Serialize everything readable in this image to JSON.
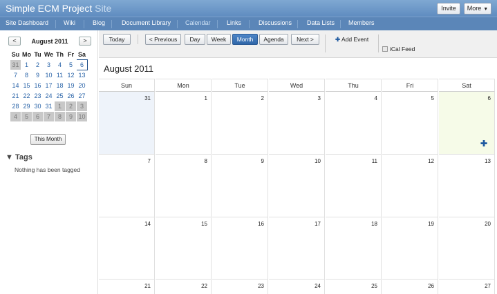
{
  "header": {
    "site_name": "Simple ECM Project",
    "site_suffix": "Site",
    "invite_label": "Invite",
    "more_label": "More"
  },
  "nav": {
    "items": [
      {
        "label": "Site Dashboard"
      },
      {
        "label": "Wiki"
      },
      {
        "label": "Blog"
      },
      {
        "label": "Document Library"
      },
      {
        "label": "Calendar"
      },
      {
        "label": "Links"
      },
      {
        "label": "Discussions"
      },
      {
        "label": "Data Lists"
      },
      {
        "label": "Members"
      }
    ],
    "active": "Calendar"
  },
  "mini_calendar": {
    "prev_label": "<",
    "next_label": ">",
    "month_label": "August 2011",
    "weekdays": [
      "Su",
      "Mo",
      "Tu",
      "We",
      "Th",
      "Fr",
      "Sa"
    ],
    "weeks": [
      [
        "31",
        "1",
        "2",
        "3",
        "4",
        "5",
        "6"
      ],
      [
        "7",
        "8",
        "9",
        "10",
        "11",
        "12",
        "13"
      ],
      [
        "14",
        "15",
        "16",
        "17",
        "18",
        "19",
        "20"
      ],
      [
        "21",
        "22",
        "23",
        "24",
        "25",
        "26",
        "27"
      ],
      [
        "28",
        "29",
        "30",
        "31",
        "1",
        "2",
        "3"
      ],
      [
        "4",
        "5",
        "6",
        "7",
        "8",
        "9",
        "10"
      ]
    ],
    "this_month_label": "This Month"
  },
  "tags": {
    "heading": "Tags",
    "toggle_icon": "triangle-down-icon",
    "empty_text": "Nothing has been tagged"
  },
  "toolbar": {
    "today_label": "Today",
    "previous_label": "< Previous",
    "views": [
      "Day",
      "Week",
      "Month",
      "Agenda"
    ],
    "active_view": "Month",
    "next_label": "Next >",
    "add_event_label": "Add Event",
    "ical_label": "iCal Feed"
  },
  "calendar": {
    "title": "August 2011",
    "weekdays": [
      "Sun",
      "Mon",
      "Tue",
      "Wed",
      "Thu",
      "Fri",
      "Sat"
    ],
    "weeks": [
      [
        "31",
        "1",
        "2",
        "3",
        "4",
        "5",
        "6"
      ],
      [
        "7",
        "8",
        "9",
        "10",
        "11",
        "12",
        "13"
      ],
      [
        "14",
        "15",
        "16",
        "17",
        "18",
        "19",
        "20"
      ],
      [
        "21",
        "22",
        "23",
        "24",
        "25",
        "26",
        "27"
      ]
    ],
    "add_icon": "plus-icon"
  },
  "colors": {
    "header_bar": "#6f9ac9",
    "nav_bar": "#5b86b8",
    "active_view": "#3a72b4",
    "today_cell": "#f6fbe8",
    "other_month_cell": "#eef3fa"
  }
}
